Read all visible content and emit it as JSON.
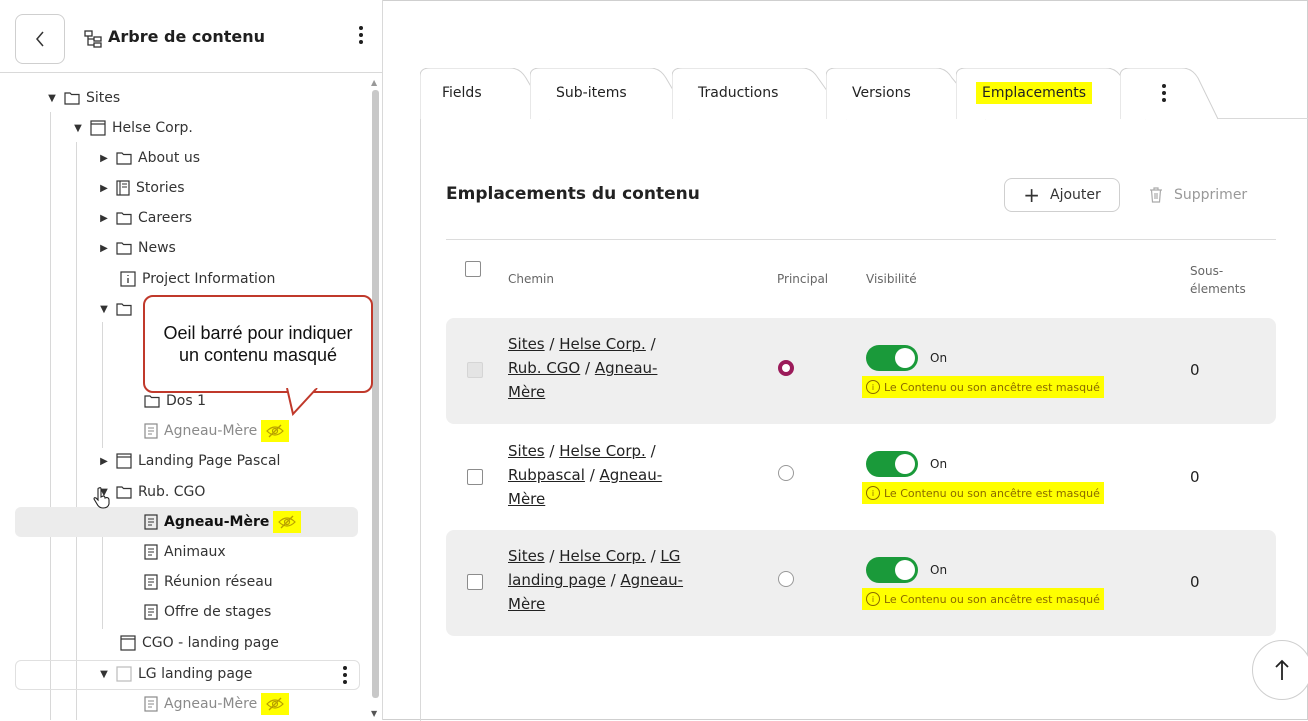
{
  "sidebar": {
    "title": "Arbre de contenu",
    "tree": {
      "sites": "Sites",
      "helse": "Helse Corp.",
      "about": "About us",
      "stories": "Stories",
      "careers": "Careers",
      "news": "News",
      "project_info": "Project Information",
      "dos1": "Dos 1",
      "agneau1": "Agneau-Mère",
      "landing_pascal": "Landing Page Pascal",
      "rub_cgo": "Rub. CGO",
      "agneau2": "Agneau-Mère",
      "animaux": "Animaux",
      "reunion": "Réunion réseau",
      "offre": "Offre de stages",
      "cgo_landing": "CGO - landing page",
      "lg_landing": "LG landing page",
      "agneau3": "Agneau-Mère"
    }
  },
  "callout": {
    "text": "Oeil barré pour indiquer un contenu masqué"
  },
  "tabs": [
    "Fields",
    "Sub-items",
    "Traductions",
    "Versions",
    "Emplacements"
  ],
  "section": {
    "title": "Emplacements du contenu",
    "add_label": "Ajouter",
    "delete_label": "Supprimer"
  },
  "table": {
    "headers": {
      "path": "Chemin",
      "principal": "Principal",
      "visibility": "Visibilité",
      "sub_line1": "Sous-",
      "sub_line2": "élements"
    },
    "rows": [
      {
        "p1": "Sites",
        "p2": "Helse Corp.",
        "p3": "Rub. CGO",
        "p4": "Agneau-",
        "p5": "Mère",
        "principal": true,
        "toggle": "On",
        "warning": "Le Contenu ou son ancêtre est masqué",
        "count": "0"
      },
      {
        "p1": "Sites",
        "p2": "Helse Corp.",
        "p3": "Rubpascal",
        "p4": "Agneau-",
        "p5": "Mère",
        "principal": false,
        "toggle": "On",
        "warning": "Le Contenu ou son ancêtre est masqué",
        "count": "0"
      },
      {
        "p1": "Sites",
        "p2": "Helse Corp.",
        "p3": "LG",
        "p3b": "landing page",
        "p4": "Agneau-",
        "p5": "Mère",
        "principal": false,
        "toggle": "On",
        "warning": "Le Contenu ou son ancêtre est masqué",
        "count": "0"
      }
    ]
  },
  "colors": {
    "toggle_on": "#1a9a3a",
    "radio_selected": "#9b1b5a",
    "highlight": "#ffff00",
    "callout_border": "#c0392b"
  }
}
